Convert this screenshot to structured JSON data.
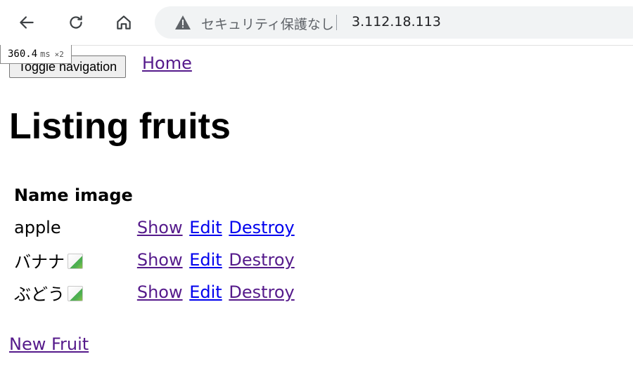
{
  "browser": {
    "security_text": "セキュリティ保護なし",
    "url": "3.112.18.113"
  },
  "timing": {
    "value": "360.4",
    "unit": "ms",
    "multiplier": "×2"
  },
  "nav": {
    "toggle_label": "Toggle navigation",
    "home_label": "Home"
  },
  "page": {
    "title": "Listing fruits"
  },
  "table": {
    "headers": [
      "Name",
      "image"
    ],
    "rows": [
      {
        "name": "apple",
        "has_broken_image": false,
        "actions": [
          "Show",
          "Edit",
          "Destroy"
        ]
      },
      {
        "name": "バナナ",
        "has_broken_image": true,
        "actions": [
          "Show",
          "Edit",
          "Destroy"
        ]
      },
      {
        "name": "ぶどう",
        "has_broken_image": true,
        "actions": [
          "Show",
          "Edit",
          "Destroy"
        ]
      }
    ]
  },
  "footer": {
    "new_fruit_label": "New Fruit"
  },
  "colors": {
    "visited_link": "#551a8b",
    "unvisited_link": "#0000ee"
  }
}
